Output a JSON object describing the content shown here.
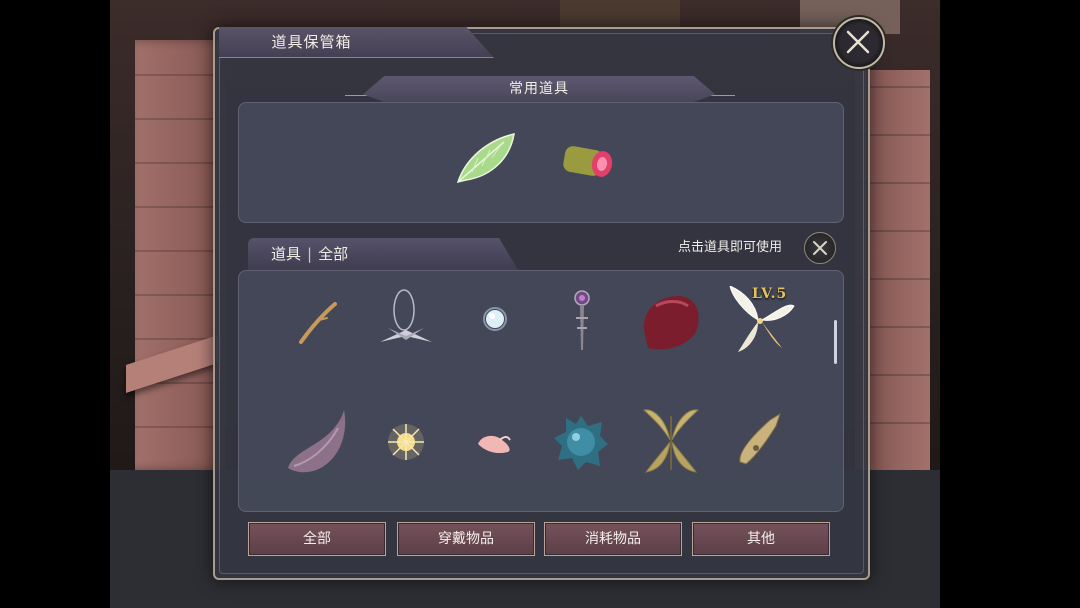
{
  "window": {
    "title": "道具保管箱"
  },
  "favorites": {
    "header": "常用道具",
    "items": [
      {
        "icon": "green-leaf-icon"
      },
      {
        "icon": "melon-slice-icon"
      }
    ]
  },
  "inventory": {
    "tab_label": "道具",
    "tab_filter": "全部",
    "hint": "点击道具即可使用",
    "level_badge": "LV.5",
    "items": [
      {
        "icon": "wooden-twig-icon"
      },
      {
        "icon": "silver-pendant-icon"
      },
      {
        "icon": "pearl-orb-icon"
      },
      {
        "icon": "jeweled-wand-icon"
      },
      {
        "icon": "crimson-stone-icon"
      },
      {
        "icon": "fairy-wings-icon"
      },
      {
        "icon": "curved-horn-icon"
      },
      {
        "icon": "glowing-spark-icon"
      },
      {
        "icon": "pink-petal-icon"
      },
      {
        "icon": "blue-spiked-gem-icon"
      },
      {
        "icon": "golden-wings-icon"
      },
      {
        "icon": "carved-shard-icon"
      }
    ]
  },
  "filters": {
    "all": "全部",
    "wearable": "穿戴物品",
    "consumable": "消耗物品",
    "other": "其他"
  }
}
